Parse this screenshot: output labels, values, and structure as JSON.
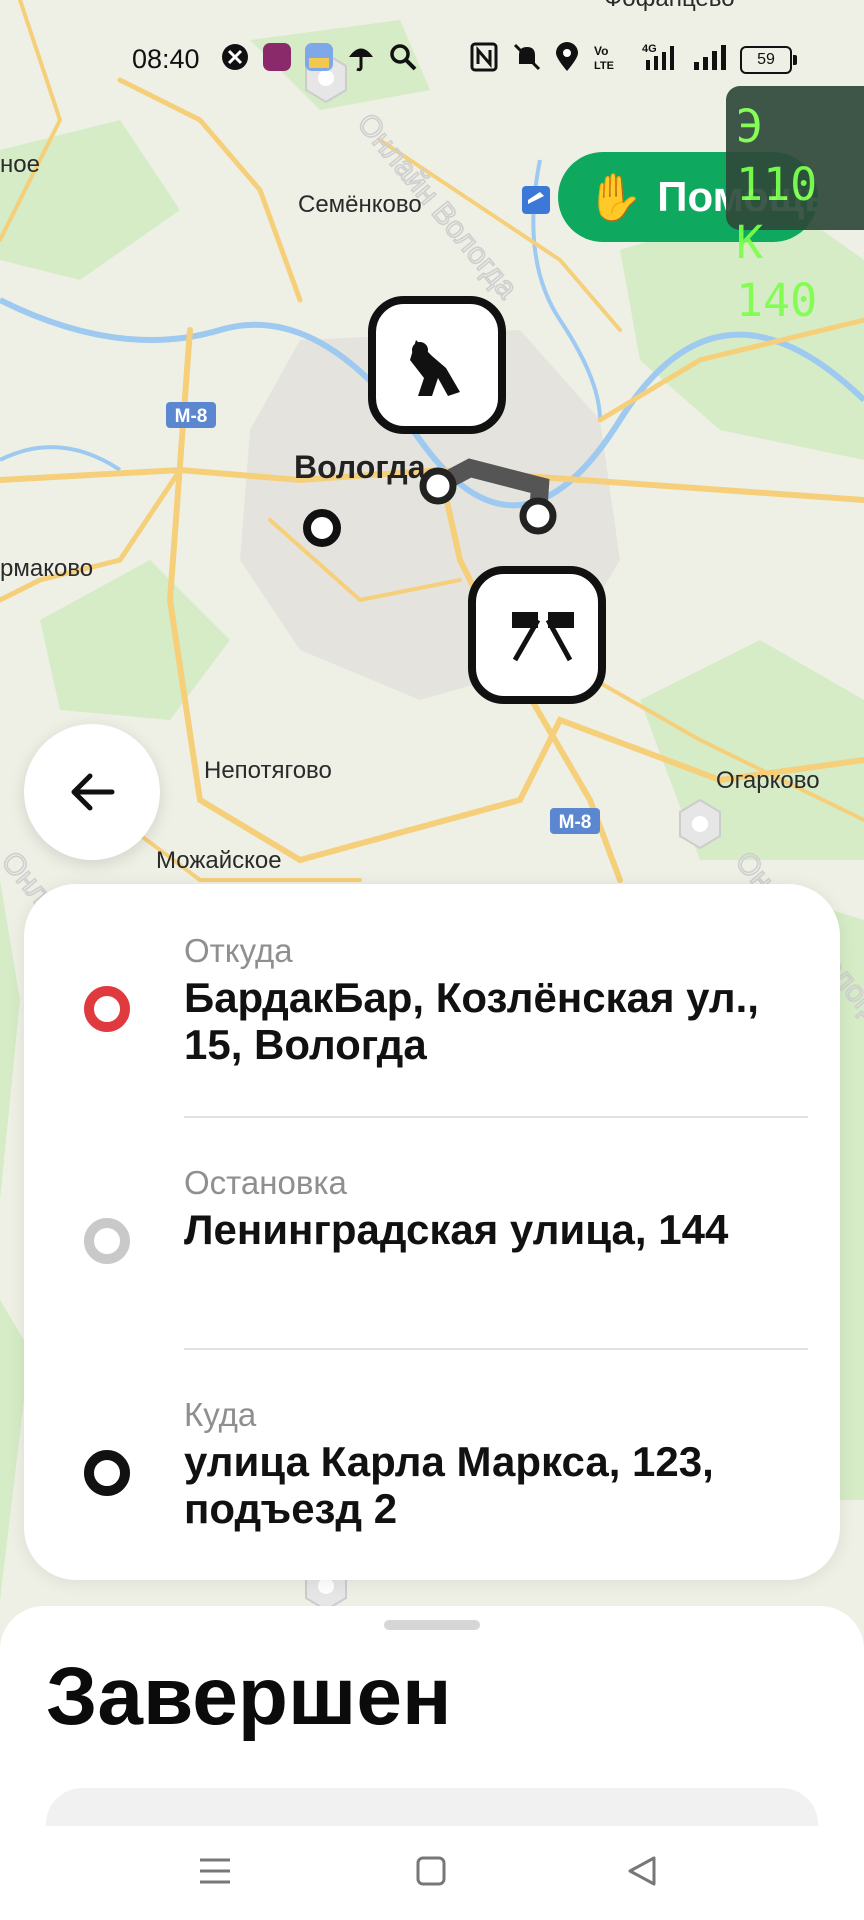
{
  "status_bar": {
    "time": "08:40",
    "network": "4G",
    "battery": "59"
  },
  "map": {
    "places": {
      "semenkovo": "Семёнково",
      "vologda": "Вологда",
      "ermakovo": "рмаково",
      "nepotyagovo": "Непотягово",
      "ogarkovo": "Огарково",
      "mozhayskoe": "Можайское",
      "fofantsevo": "Фофанцево",
      "left_edge": "ное"
    },
    "road_badges": [
      "М-8",
      "М-8"
    ],
    "watermark": "Онлайн Вологда"
  },
  "help_button": {
    "label": "Помощь"
  },
  "price_overlay": {
    "economy": "Э 110",
    "comfort": "К 140"
  },
  "route": {
    "from": {
      "label": "Откуда",
      "address": "БардакБар, Козлёнская ул., 15, Вологда",
      "dot_color": "#e0393e"
    },
    "stop": {
      "label": "Остановка",
      "address": "Ленинградская улица, 144",
      "dot_color": "#c9c9c9"
    },
    "to": {
      "label": "Куда",
      "address": "улица Карла Маркса, 123, подъезд 2",
      "dot_color": "#111111"
    }
  },
  "order": {
    "status": "Завершен"
  },
  "colors": {
    "accent_green": "#0fa85f",
    "road": "#f6cf7b"
  }
}
